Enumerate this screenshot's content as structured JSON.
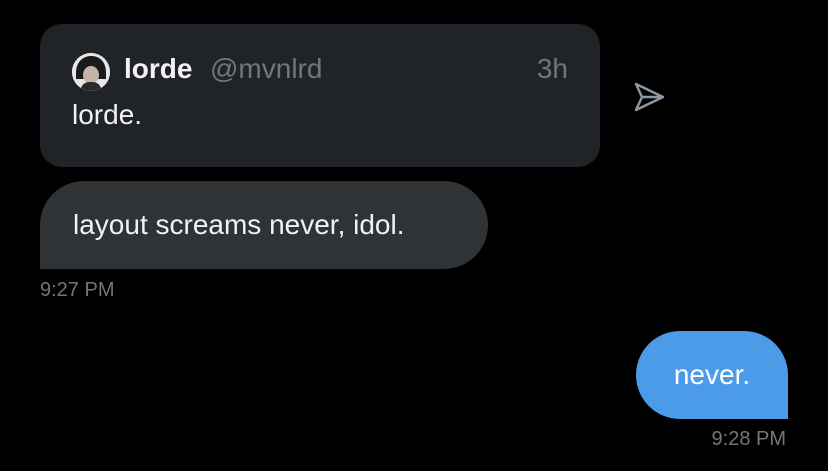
{
  "quoted_tweet": {
    "name": "lorde",
    "handle": "@mvnlrd",
    "time": "3h",
    "text": "lorde.",
    "avatar_icon": "profile-photo"
  },
  "share": {
    "icon": "send-icon"
  },
  "messages": [
    {
      "direction": "received",
      "text": "layout screams never, idol.",
      "time": "9:27 PM"
    },
    {
      "direction": "sent",
      "text": "never.",
      "time": "9:28 PM"
    }
  ],
  "colors": {
    "background": "#000000",
    "card": "#202327",
    "received_bubble": "#2f3336",
    "sent_bubble": "#4c9be8",
    "secondary_text": "#71767b"
  }
}
